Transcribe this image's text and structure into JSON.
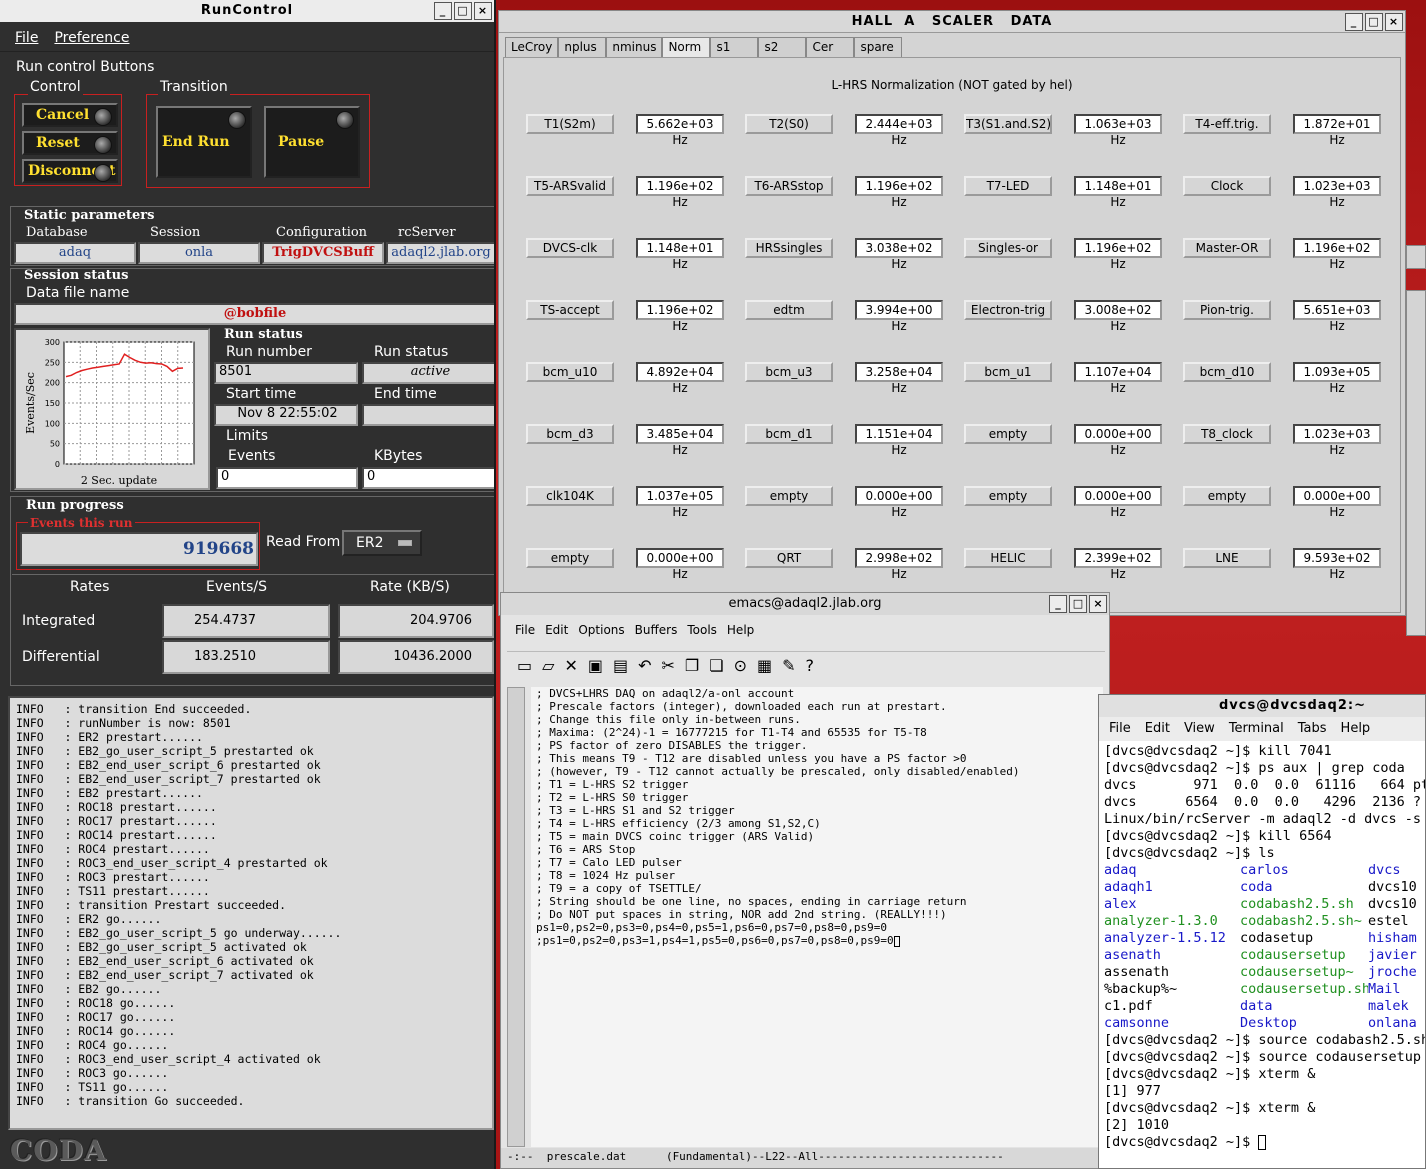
{
  "runcontrol": {
    "title": "RunControl",
    "menu": [
      "File",
      "Preference"
    ],
    "buttons_group": "Run control Buttons",
    "control_label": "Control",
    "transition_label": "Transition",
    "cancel": "Cancel",
    "reset": "Reset",
    "disconnect": "Disconnect",
    "end_run": "End Run",
    "pause": "Pause",
    "static_params": "Static parameters",
    "database_label": "Database",
    "session_label": "Session",
    "config_label": "Configuration",
    "rcserver_label": "rcServer",
    "database": "adaq",
    "session": "onla",
    "configuration": "TrigDVCSBuff",
    "rcserver": "adaql2.jlab.org",
    "session_status": "Session status",
    "data_file_label": "Data file name",
    "data_file": "@bobfile",
    "run_status_title": "Run status",
    "run_number_label": "Run number",
    "run_number": "8501",
    "run_status_label": "Run status",
    "run_status": "active",
    "start_time_label": "Start time",
    "start_time": "Nov 8 22:55:02",
    "end_time_label": "End time",
    "end_time": "",
    "limits_label": "Limits",
    "events_label": "Events",
    "kbytes_label": "KBytes",
    "events_limit": "0",
    "kbytes_limit": "0",
    "run_progress": "Run progress",
    "events_this_run_label": "Events this run",
    "events_this_run": "919668",
    "read_from_label": "Read From:",
    "read_from": "ER2",
    "rates_header": "Rates",
    "events_s_header": "Events/S",
    "rate_kb_header": "Rate (KB/S)",
    "integrated_label": "Integrated",
    "integrated_events": "254.4737",
    "integrated_rate": "204.9706",
    "differential_label": "Differential",
    "differential_events": "183.2510",
    "differential_rate": "10436.2000",
    "logo": "CODA"
  },
  "rate_chart": {
    "chart_data": {
      "type": "line",
      "ylabel": "Events/Sec",
      "xlabel": "2 Sec. update",
      "ylim": [
        0,
        300
      ],
      "y_ticks": [
        "300",
        "250",
        "200",
        "150",
        "100",
        "50",
        "0"
      ],
      "values": [
        215,
        218,
        225,
        230,
        233,
        236,
        238,
        240,
        242,
        244,
        246,
        270,
        262,
        255,
        250,
        248,
        249,
        247,
        246,
        240,
        228,
        235,
        236
      ]
    }
  },
  "log_lines": [
    "INFO   : transition End succeeded.",
    "INFO   : runNumber is now: 8501",
    "INFO   : ER2 prestart......",
    "INFO   : EB2_go_user_script_5 prestarted ok",
    "INFO   : EB2_end_user_script_6 prestarted ok",
    "INFO   : EB2_end_user_script_7 prestarted ok",
    "INFO   : EB2 prestart......",
    "INFO   : ROC18 prestart......",
    "INFO   : ROC17 prestart......",
    "INFO   : ROC14 prestart......",
    "INFO   : ROC4 prestart......",
    "INFO   : ROC3_end_user_script_4 prestarted ok",
    "INFO   : ROC3 prestart......",
    "INFO   : TS11 prestart......",
    "INFO   : transition Prestart succeeded.",
    "INFO   : ER2 go......",
    "INFO   : EB2_go_user_script_5 go underway......",
    "INFO   : EB2_go_user_script_5 activated ok",
    "INFO   : EB2_end_user_script_6 activated ok",
    "INFO   : EB2_end_user_script_7 activated ok",
    "INFO   : EB2 go......",
    "INFO   : ROC18 go......",
    "INFO   : ROC17 go......",
    "INFO   : ROC14 go......",
    "INFO   : ROC4 go......",
    "INFO   : ROC3_end_user_script_4 activated ok",
    "INFO   : ROC3 go......",
    "INFO   : TS11 go......",
    "INFO   : transition Go succeeded."
  ],
  "scaler": {
    "title": "HALL  A   SCALER   DATA",
    "tabs": [
      "LeCroy",
      "nplus",
      "nminus",
      "Norm",
      "s1",
      "s2",
      "Cer",
      "spare"
    ],
    "selected_tab": "Norm",
    "panel_title": "L-HRS Normalization (NOT gated by hel)",
    "rows": [
      [
        [
          "T1(S2m)",
          "5.662e+03 Hz"
        ],
        [
          "T2(S0)",
          "2.444e+03 Hz"
        ],
        [
          "T3(S1.and.S2)",
          "1.063e+03 Hz"
        ],
        [
          "T4-eff.trig.",
          "1.872e+01 Hz"
        ]
      ],
      [
        [
          "T5-ARSvalid",
          "1.196e+02 Hz"
        ],
        [
          "T6-ARSstop",
          "1.196e+02 Hz"
        ],
        [
          "T7-LED",
          "1.148e+01 Hz"
        ],
        [
          "Clock",
          "1.023e+03 Hz"
        ]
      ],
      [
        [
          "DVCS-clk",
          "1.148e+01 Hz"
        ],
        [
          "HRSsingles",
          "3.038e+02 Hz"
        ],
        [
          "Singles-or",
          "1.196e+02 Hz"
        ],
        [
          "Master-OR",
          "1.196e+02 Hz"
        ]
      ],
      [
        [
          "TS-accept",
          "1.196e+02 Hz"
        ],
        [
          "edtm",
          "3.994e+00 Hz"
        ],
        [
          "Electron-trig",
          "3.008e+02 Hz"
        ],
        [
          "Pion-trig.",
          "5.651e+03 Hz"
        ]
      ],
      [
        [
          "bcm_u10",
          "4.892e+04 Hz"
        ],
        [
          "bcm_u3",
          "3.258e+04 Hz"
        ],
        [
          "bcm_u1",
          "1.107e+04 Hz"
        ],
        [
          "bcm_d10",
          "1.093e+05 Hz"
        ]
      ],
      [
        [
          "bcm_d3",
          "3.485e+04 Hz"
        ],
        [
          "bcm_d1",
          "1.151e+04 Hz"
        ],
        [
          "empty",
          "0.000e+00 Hz"
        ],
        [
          "T8_clock",
          "1.023e+03 Hz"
        ]
      ],
      [
        [
          "clk104K",
          "1.037e+05 Hz"
        ],
        [
          "empty",
          "0.000e+00 Hz"
        ],
        [
          "empty",
          "0.000e+00 Hz"
        ],
        [
          "empty",
          "0.000e+00 Hz"
        ]
      ],
      [
        [
          "empty",
          "0.000e+00 Hz"
        ],
        [
          "QRT",
          "2.998e+02 Hz"
        ],
        [
          "HELIC",
          "2.399e+02 Hz"
        ],
        [
          "LNE",
          "9.593e+02 Hz"
        ]
      ]
    ]
  },
  "emacs": {
    "title": "emacs@adaql2.jlab.org",
    "menu": [
      "File",
      "Edit",
      "Options",
      "Buffers",
      "Tools",
      "Help"
    ],
    "toolbar_icons": [
      "new-file-icon",
      "open-folder-icon",
      "close-icon",
      "save-icon",
      "save-as-icon",
      "undo-icon",
      "cut-icon",
      "copy-icon",
      "paste-icon",
      "search-icon",
      "print-icon",
      "customize-icon",
      "help-icon"
    ],
    "lines": [
      "; DVCS+LHRS DAQ on adaql2/a-onl account",
      "; Prescale factors (integer), downloaded each run at prestart.",
      "; Change this file only in-between runs.",
      "; Maxima: (2^24)-1 = 16777215 for T1-T4 and 65535 for T5-T8",
      "; PS factor of zero DISABLES the trigger.",
      "; This means T9 - T12 are disabled unless you have a PS factor >0",
      "; (however, T9 - T12 cannot actually be prescaled, only disabled/enabled)",
      "; T1 = L-HRS S2 trigger",
      "; T2 = L-HRS S0 trigger",
      "; T3 = L-HRS S1 and S2 trigger",
      "; T4 = L-HRS efficiency (2/3 among S1,S2,C)",
      "; T5 = main DVCS coinc trigger (ARS Valid)",
      "; T6 = ARS Stop",
      "; T7 = Calo LED pulser",
      "; T8 = 1024 Hz pulser",
      "; T9 = a copy of TSETTLE/",
      "; String should be one line, no spaces, ending in carriage return",
      "; Do NOT put spaces in string, NOR add 2nd string. (REALLY!!!)",
      "",
      "",
      "ps1=0,ps2=0,ps3=0,ps4=0,ps5=1,ps6=0,ps7=0,ps8=0,ps9=0",
      ";ps1=0,ps2=0,ps3=1,ps4=1,ps5=0,ps6=0,ps7=0,ps8=0,ps9=0"
    ],
    "modeline": "-:--  prescale.dat      (Fundamental)--L22--All----------------------------"
  },
  "terminal": {
    "title": "dvcs@dvcsdaq2:~",
    "menu": [
      "File",
      "Edit",
      "View",
      "Terminal",
      "Tabs",
      "Help"
    ],
    "lines_top": [
      "[dvcs@dvcsdaq2 ~]$ kill 7041",
      "[dvcs@dvcsdaq2 ~]$ ps aux | grep coda",
      "dvcs       971  0.0  0.0  61116   664 pts",
      "dvcs      6564  0.0  0.0   4296  2136 ?",
      "Linux/bin/rcServer -m adaql2 -d dvcs -s o",
      "[dvcs@dvcsdaq2 ~]$ kill 6564",
      "[dvcs@dvcsdaq2 ~]$ ls"
    ],
    "ls": [
      [
        [
          "adaq",
          "dir"
        ],
        [
          "carlos",
          "dir"
        ],
        [
          "dvcs",
          "dir"
        ]
      ],
      [
        [
          "adaqh1",
          "dir"
        ],
        [
          "coda",
          "dir"
        ],
        [
          "dvcs10",
          ""
        ]
      ],
      [
        [
          "alex",
          "dir"
        ],
        [
          "codabash2.5.sh",
          "exe"
        ],
        [
          "dvcs10",
          ""
        ]
      ],
      [
        [
          "analyzer-1.3.0",
          "exe"
        ],
        [
          "codabash2.5.sh~",
          "exe"
        ],
        [
          "estel",
          ""
        ]
      ],
      [
        [
          "analyzer-1.5.12",
          "dir"
        ],
        [
          "codasetup",
          ""
        ],
        [
          "hisham",
          "dir"
        ]
      ],
      [
        [
          "asenath",
          "dir"
        ],
        [
          "codausersetup",
          "exe"
        ],
        [
          "javier",
          "dir"
        ]
      ],
      [
        [
          "assenath",
          ""
        ],
        [
          "codausersetup~",
          "exe"
        ],
        [
          "jroche",
          "dir"
        ]
      ],
      [
        [
          "%backup%~",
          ""
        ],
        [
          "codausersetup.sh",
          "exe"
        ],
        [
          "Mail",
          "dir"
        ]
      ],
      [
        [
          "c1.pdf",
          ""
        ],
        [
          "data",
          "dir"
        ],
        [
          "malek",
          "dir"
        ]
      ],
      [
        [
          "camsonne",
          "dir"
        ],
        [
          "Desktop",
          "dir"
        ],
        [
          "onlana",
          "dir"
        ]
      ]
    ],
    "lines_bottom": [
      "[dvcs@dvcsdaq2 ~]$ source codabash2.5.sh",
      "[dvcs@dvcsdaq2 ~]$ source codausersetup",
      "[dvcs@dvcsdaq2 ~]$ xterm &",
      "[1] 977",
      "[dvcs@dvcsdaq2 ~]$ xterm &",
      "[2] 1010",
      "[dvcs@dvcsdaq2 ~]$ "
    ]
  }
}
